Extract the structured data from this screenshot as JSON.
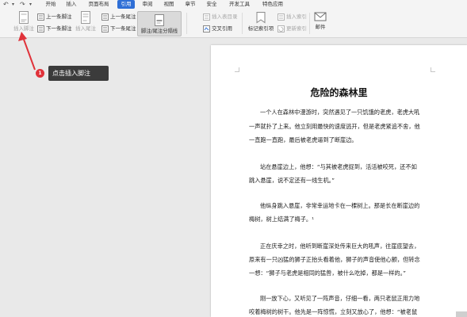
{
  "quick_access": {
    "undo": "↶",
    "redo": "↷"
  },
  "menu_tabs": [
    "开始",
    "插入",
    "页面布局",
    "引用",
    "审阅",
    "视图",
    "章节",
    "安全",
    "开发工具",
    "特色应用"
  ],
  "active_tab_index": 3,
  "ribbon": {
    "insert_footnote": "插入脚注",
    "prev_footnote": "上一条脚注",
    "next_footnote": "下一条脚注",
    "insert_endnote": "插入尾注",
    "prev_endnote": "上一条尾注",
    "next_endnote": "下一条尾注",
    "footnote_separator": "脚注/尾注分隔线",
    "insert_caption_catalog": "插入表目录",
    "cross_reference": "交叉引用",
    "mark_index_item": "标记索引项",
    "insert_index": "插入索引",
    "update_index": "更新索引",
    "mail": "邮件"
  },
  "tooltip": {
    "badge": "1",
    "text": "点击插入脚注"
  },
  "document": {
    "title": "危险的森林里",
    "lines": [
      "一个人在森林中漫游时，突然遇见了一只饥饿的老虎，老虎大吼",
      "一声就扑了上来。他立刻用最快的速度逃开，但是老虎紧追不舍，他",
      "一直跑一直跑，最后被老虎逼到了断崖边。",
      "",
      "站在悬崖边上，他想：“与其被老虎捉到，活活被咬死，还不如",
      "跳入悬崖，说不定还有一线生机。”",
      "",
      "他纵身跳入悬崖，非常幸运地卡在一棵树上。那是长在断崖边的",
      "梅树，树上结满了梅子。¹",
      "",
      "正在庆幸之时，他听到断崖深处传来巨大的吼声，往崖底望去，",
      "原来有一只凶猛的狮子正抬头看着他，狮子的声音使他心颤，但转念",
      "一想：“狮子与老虎是相同的猛兽，被什么吃掉，都是一样的。”",
      "",
      "刚一放下心，又听见了一阵声音，仔细一看，两只老鼠正用力地",
      "咬着梅树的树干。他先是一阵惊慌，立刻又放心了，他想：“被老鼠"
    ]
  }
}
